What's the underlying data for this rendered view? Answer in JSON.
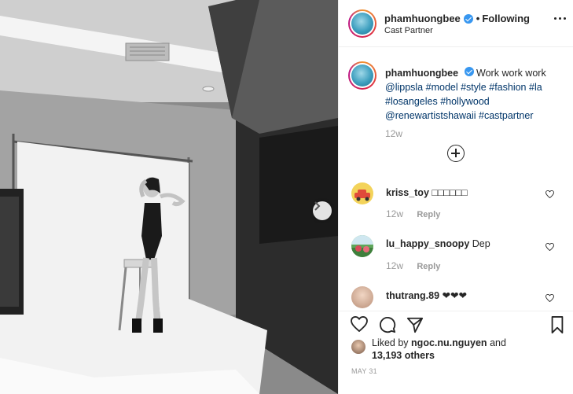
{
  "post": {
    "header": {
      "username": "phamhuongbee",
      "separator": "•",
      "follow_status": "Following",
      "subtitle": "Cast Partner"
    },
    "caption": {
      "username": "phamhuongbee",
      "text": "Work work work",
      "hashtags": [
        "@lippsla",
        "#model",
        "#style",
        "#fashion",
        "#la",
        "#losangeles",
        "#hollywood",
        "@renewartistshawaii",
        "#castpartner"
      ],
      "time": "12w"
    },
    "comments": [
      {
        "username": "kriss_toy",
        "text": "□□□□□□",
        "time": "12w",
        "reply_label": "Reply"
      },
      {
        "username": "lu_happy_snoopy",
        "text": "Dep",
        "time": "12w",
        "reply_label": "Reply"
      },
      {
        "username": "thutrang.89",
        "text": "❤❤❤"
      }
    ],
    "likes": {
      "prefix": "Liked by",
      "user": "ngoc.nu.nguyen",
      "and": "and",
      "count": "13,193 others"
    },
    "date": "MAY 31"
  },
  "icons": {
    "next": "chevron-right-icon",
    "verified": "verified-badge-icon",
    "more": "more-options-icon",
    "load_more": "plus-circle-icon",
    "like": "heart-icon",
    "comment": "comment-icon",
    "share": "share-icon",
    "save": "bookmark-icon"
  },
  "colors": {
    "link": "#003569",
    "verified": "#3897f0",
    "muted": "#999999"
  }
}
